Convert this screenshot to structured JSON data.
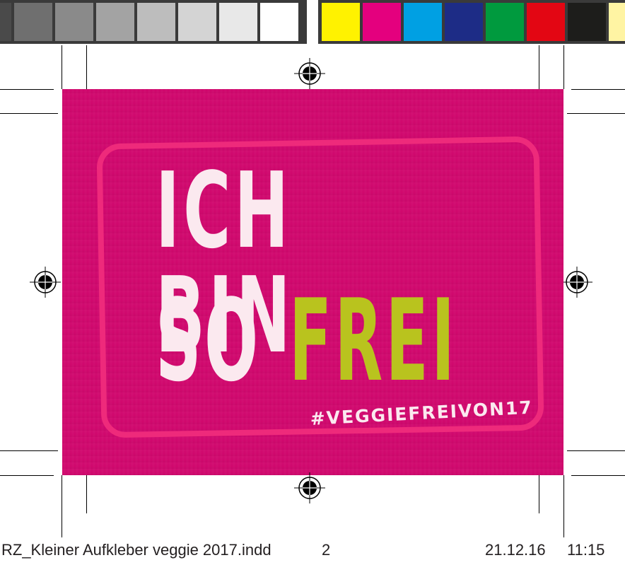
{
  "color_bar": {
    "gray_swatches": [
      "#4a4a4a",
      "#6f6f6f",
      "#8a8a8a",
      "#a3a3a3",
      "#bdbdbd",
      "#d4d4d4",
      "#e8e8e8",
      "#ffffff"
    ],
    "process_swatches": [
      "#fff200",
      "#e4007e",
      "#00a0e3",
      "#1d2c86",
      "#009a3e",
      "#e30613",
      "#1d1d1b",
      "#fff4a3"
    ]
  },
  "sticker": {
    "line1": "ICH BIN",
    "line2_white": "SO",
    "line2_green": "FREI",
    "hashtag": "#VEGGIEFREIVON17",
    "bg_color": "#d0076d",
    "accent_color": "#b9c31e"
  },
  "slug": {
    "filename": "RZ_Kleiner Aufkleber veggie 2017.indd",
    "page": "2",
    "date": "21.12.16",
    "time": "11:15"
  }
}
